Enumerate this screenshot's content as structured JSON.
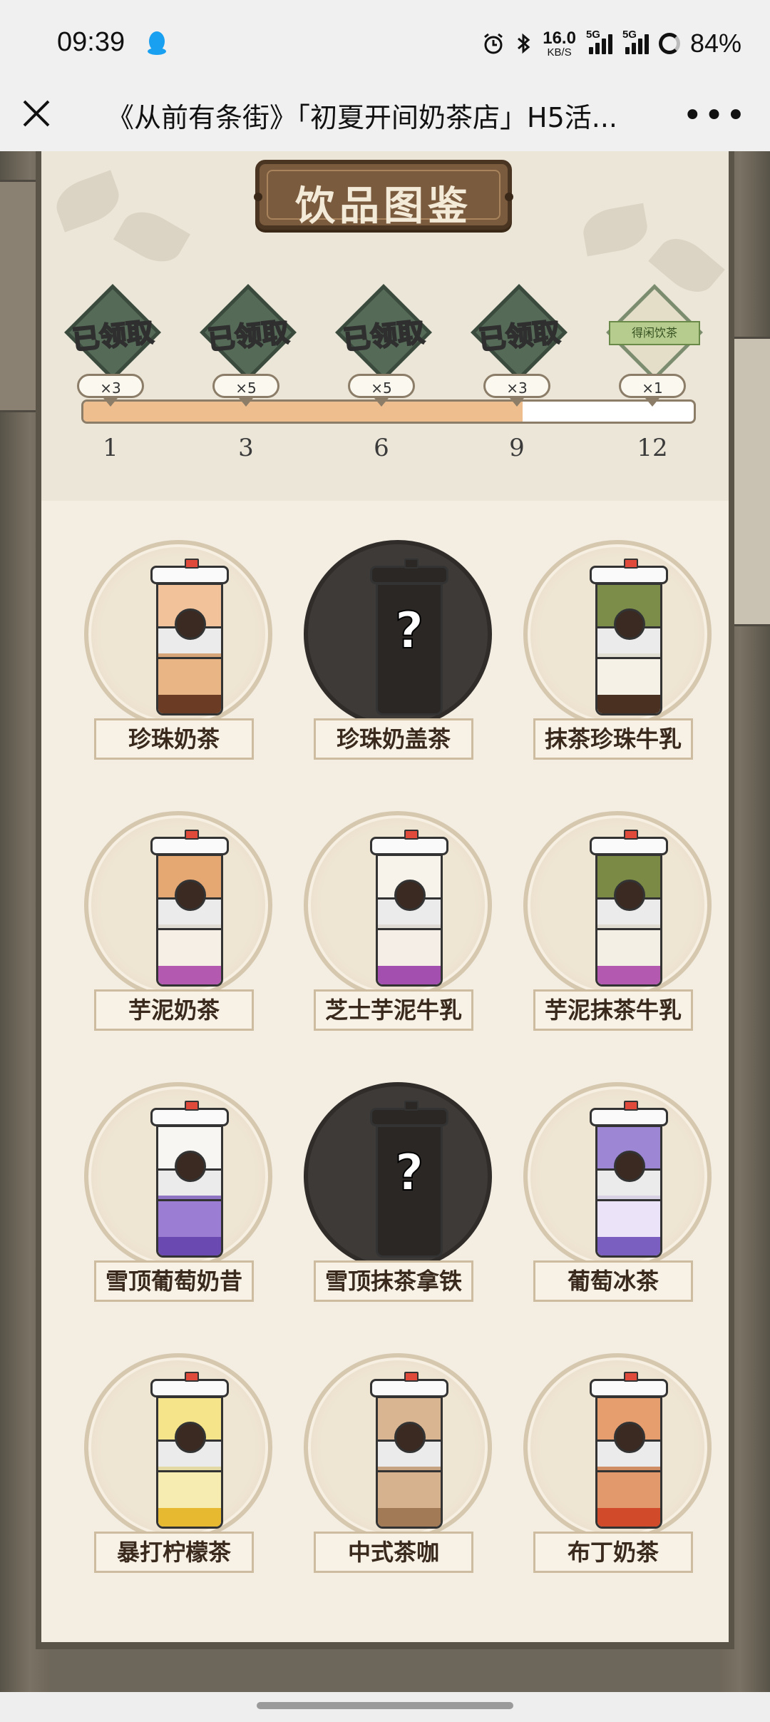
{
  "status_bar": {
    "time": "09:39",
    "net_speed_value": "16.0",
    "net_speed_unit": "KB/S",
    "signal1_label": "5G",
    "signal2_label": "5G",
    "battery": "84%",
    "icons": [
      "qq-penguin-icon",
      "alarm-icon",
      "bluetooth-icon",
      "signal-icon",
      "battery-ring-icon"
    ]
  },
  "title_bar": {
    "title": "《从前有条街》「初夏开间奶茶店」H5活...",
    "close_icon": "close-icon",
    "more_icon": "more-icon"
  },
  "panel": {
    "heading": "饮品图鉴",
    "progress_fraction": 0.72,
    "rewards": [
      {
        "status": "已领取",
        "qty": "×3",
        "milestone": "1",
        "claimed": true
      },
      {
        "status": "已领取",
        "qty": "×5",
        "milestone": "3",
        "claimed": true
      },
      {
        "status": "已领取",
        "qty": "×5",
        "milestone": "6",
        "claimed": true
      },
      {
        "status": "已领取",
        "qty": "×3",
        "milestone": "9",
        "claimed": true
      },
      {
        "status": "",
        "qty": "×1",
        "milestone": "12",
        "claimed": false,
        "gift": "得闲饮茶"
      }
    ]
  },
  "drinks": [
    {
      "name": "珍珠奶茶",
      "unlocked": true,
      "top": "#f2c29a",
      "bottom": "#e9b585",
      "accent": "#6b3b23"
    },
    {
      "name": "珍珠奶盖茶",
      "unlocked": false
    },
    {
      "name": "抹茶珍珠牛乳",
      "unlocked": true,
      "top": "#7c8d4a",
      "bottom": "#f5f1e6",
      "accent": "#4a3020"
    },
    {
      "name": "芋泥奶茶",
      "unlocked": true,
      "top": "#e6a873",
      "bottom": "#f5efe5",
      "accent": "#b35ab0"
    },
    {
      "name": "芝士芋泥牛乳",
      "unlocked": true,
      "top": "#f7f3ea",
      "bottom": "#f4eee6",
      "accent": "#a24fb0"
    },
    {
      "name": "芋泥抹茶牛乳",
      "unlocked": true,
      "top": "#7b8a45",
      "bottom": "#f3efe4",
      "accent": "#b35ab0"
    },
    {
      "name": "雪顶葡萄奶昔",
      "unlocked": true,
      "top": "#f8f6f2",
      "bottom": "#9b7ed4",
      "accent": "#6a4ab0"
    },
    {
      "name": "雪顶抹茶拿铁",
      "unlocked": false
    },
    {
      "name": "葡萄冰茶",
      "unlocked": true,
      "top": "#9d86d4",
      "bottom": "#ebe3f7",
      "accent": "#7a5fc0"
    },
    {
      "name": "暴打柠檬茶",
      "unlocked": true,
      "top": "#f5e48a",
      "bottom": "#f6ecb2",
      "accent": "#e6b930"
    },
    {
      "name": "中式茶咖",
      "unlocked": true,
      "top": "#d9b592",
      "bottom": "#d7b28e",
      "accent": "#a27a56"
    },
    {
      "name": "布丁奶茶",
      "unlocked": true,
      "top": "#e79e6f",
      "bottom": "#e29a6c",
      "accent": "#d14a2a"
    }
  ]
}
